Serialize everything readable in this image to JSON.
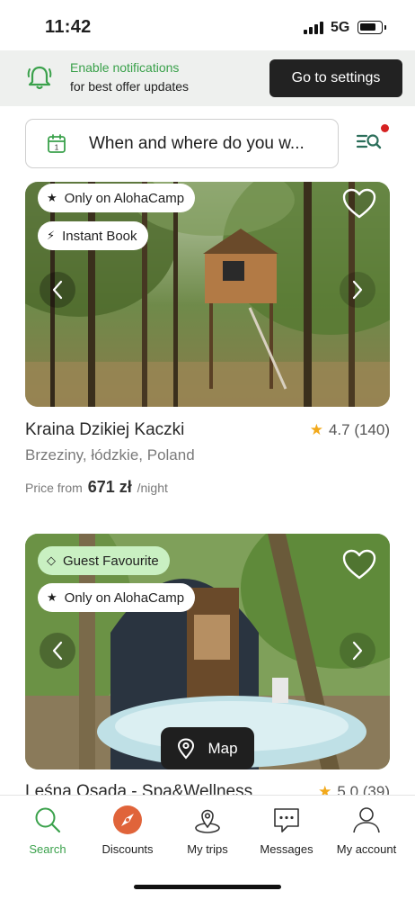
{
  "status": {
    "time": "11:42",
    "network": "5G"
  },
  "notification": {
    "title": "Enable notifications",
    "subtitle": "for best offer updates",
    "button": "Go to settings"
  },
  "search": {
    "placeholder": "When and where do you w..."
  },
  "cards": [
    {
      "badges": [
        "Only on AlohaCamp",
        "Instant Book"
      ],
      "title": "Kraina Dzikiej Kaczki",
      "rating": "4.7",
      "reviews": "(140)",
      "location": "Brzeziny, łódzkie, Poland",
      "price_prefix": "Price from",
      "price": "671 zł",
      "price_suffix": "/night"
    },
    {
      "badges": [
        "Guest Favourite",
        "Only on AlohaCamp"
      ],
      "title": "Leśna Osada - Spa&Wellness",
      "rating": "5.0",
      "reviews": "(39)"
    }
  ],
  "map_button": "Map",
  "tabs": [
    {
      "label": "Search",
      "icon": "search-icon",
      "active": true
    },
    {
      "label": "Discounts",
      "icon": "compass-icon"
    },
    {
      "label": "My trips",
      "icon": "trips-pin-icon"
    },
    {
      "label": "Messages",
      "icon": "message-icon"
    },
    {
      "label": "My account",
      "icon": "person-icon"
    }
  ],
  "colors": {
    "accent": "#3aa14b",
    "dark": "#1f1f1f",
    "star": "#f2a91b",
    "alert": "#d62222"
  }
}
